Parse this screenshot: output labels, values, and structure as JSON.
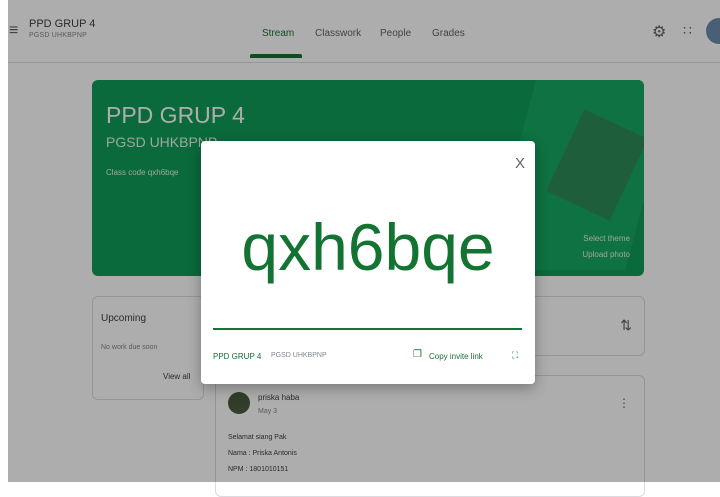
{
  "header": {
    "class_name": "PPD GRUP 4",
    "class_section": "PGSD UHKBPNP",
    "tabs": [
      "Stream",
      "Classwork",
      "People",
      "Grades"
    ],
    "active_tab": "Stream"
  },
  "banner": {
    "title": "PPD GRUP 4",
    "subtitle": "PGSD UHKBPNP",
    "class_code": "Class code  qxh6bqe",
    "select_theme": "Select theme",
    "upload_photo": "Upload photo"
  },
  "upcoming": {
    "title": "Upcoming",
    "empty_text": "No work due soon",
    "view_all": "View all"
  },
  "post": {
    "author": "priska haba",
    "date": "May 3",
    "lines": [
      "Selamat siang Pak",
      "Nama : Priska Antonis",
      "NPM : 1801010151"
    ]
  },
  "dialog": {
    "code": "qxh6bqe",
    "class_name": "PPD GRUP 4",
    "class_section": "PGSD UHKBPNP",
    "copy_link": "Copy invite link",
    "close_symbol": "X"
  },
  "colors": {
    "accent": "#137333",
    "banner": "#0f9d58"
  }
}
